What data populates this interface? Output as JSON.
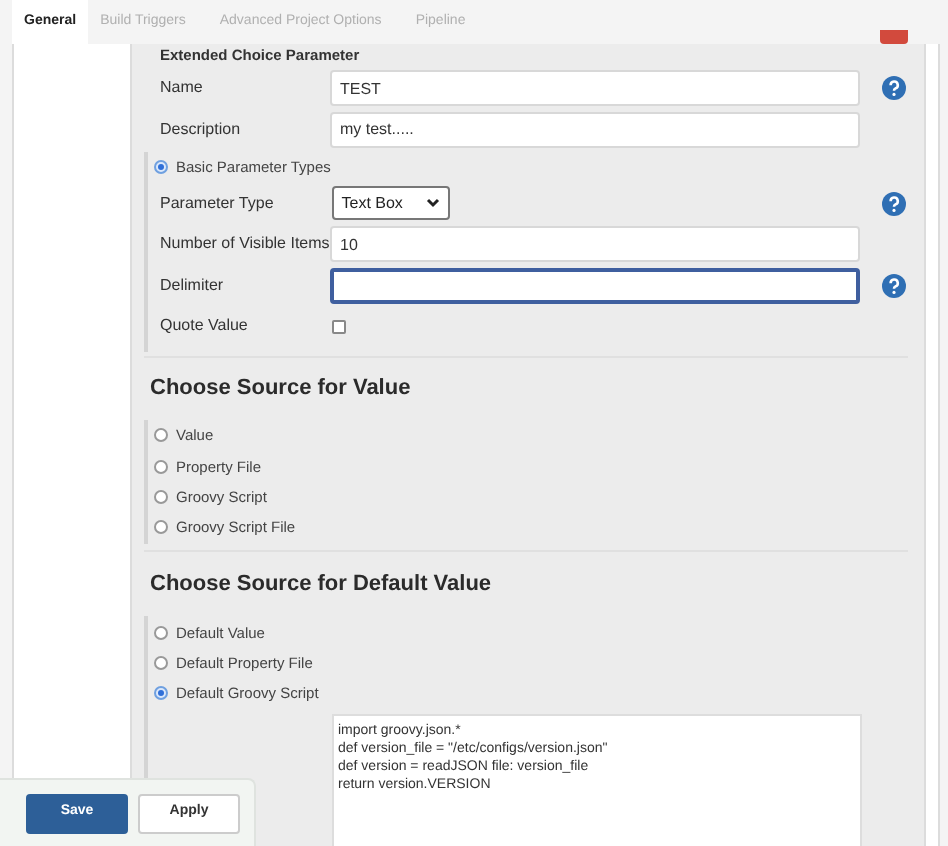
{
  "tabs": [
    {
      "label": "General",
      "selected": true
    },
    {
      "label": "Build Triggers",
      "selected": false
    },
    {
      "label": "Advanced Project Options",
      "selected": false
    },
    {
      "label": "Pipeline",
      "selected": false
    }
  ],
  "parameter": {
    "title": "Extended Choice Parameter",
    "fields": [
      {
        "kind": "text",
        "label": "Name",
        "value": "TEST",
        "help": true
      },
      {
        "kind": "text",
        "label": "Description",
        "value": "my test.....",
        "help": false
      }
    ],
    "type_group": {
      "label": "Basic Parameter Types",
      "selected": true,
      "fields": [
        {
          "kind": "select",
          "label": "Parameter Type",
          "value": "Text Box",
          "help": true
        },
        {
          "kind": "text",
          "label": "Number of Visible Items",
          "value": "10",
          "help": false
        },
        {
          "kind": "text",
          "label": "Delimiter",
          "focused": true,
          "help": true
        },
        {
          "kind": "checkbox",
          "label": "Quote Value",
          "checked": false,
          "help": false
        }
      ]
    }
  },
  "value_source": {
    "heading": "Choose Source for Value",
    "options": [
      {
        "label": "Value",
        "selected": false
      },
      {
        "label": "Property File",
        "selected": false
      },
      {
        "label": "Groovy Script",
        "selected": false
      },
      {
        "label": "Groovy Script File",
        "selected": false
      }
    ]
  },
  "default_source": {
    "heading": "Choose Source for Default Value",
    "options": [
      {
        "label": "Default Value",
        "selected": false
      },
      {
        "label": "Default Property File",
        "selected": false
      },
      {
        "label": "Default Groovy Script",
        "selected": true
      }
    ],
    "script": "import groovy.json.*\ndef version_file = \"/etc/configs/version.json\"\ndef version = readJSON file: version_file\nreturn version.VERSION"
  },
  "buttons": [
    {
      "label": "Save",
      "kind": "primary"
    },
    {
      "label": "Apply",
      "kind": "secondary"
    }
  ]
}
